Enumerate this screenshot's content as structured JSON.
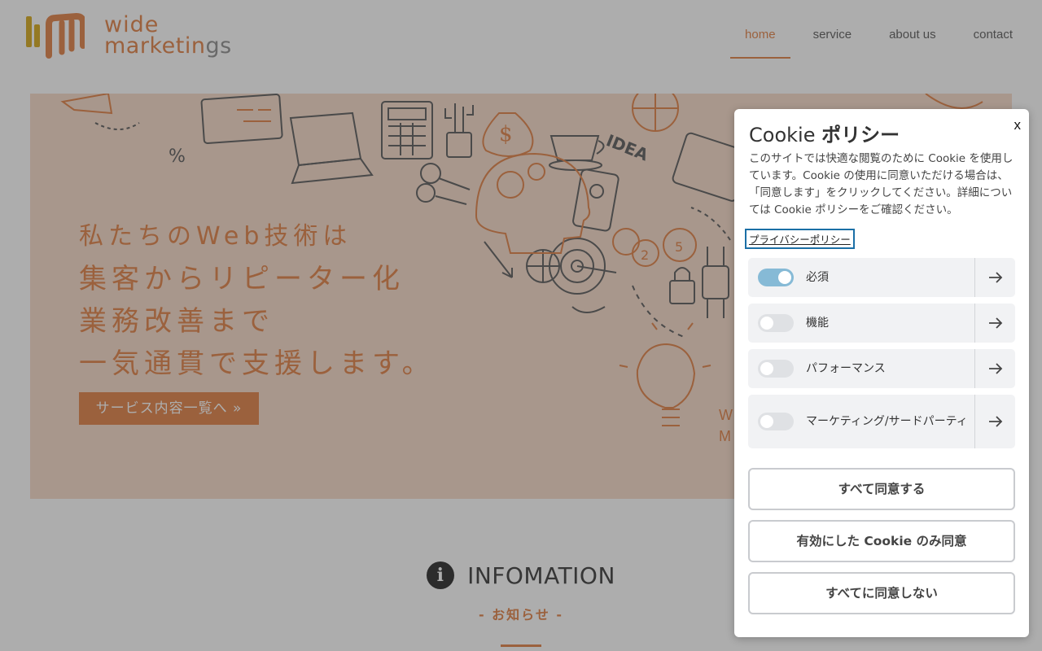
{
  "header": {
    "logo": {
      "line1": "wide",
      "line2_a": "marketin",
      "line2_b": "gs"
    },
    "nav": [
      {
        "label": "home",
        "active": true
      },
      {
        "label": "service",
        "active": false
      },
      {
        "label": "about us",
        "active": false
      },
      {
        "label": "contact",
        "active": false
      }
    ]
  },
  "hero": {
    "lines": [
      "私たちのWeb技術は",
      "集客からリピーター化",
      "業務改善まで",
      "一気通貫で支援します。"
    ],
    "button_label": "サービス内容一覧へ »",
    "tag_line1": "W",
    "tag_line2": "M",
    "doodle_labels": {
      "idea": "IDEA",
      "percent": "%",
      "dollar": "$",
      "coin2": "2",
      "coin5": "5"
    }
  },
  "info": {
    "icon_glyph": "i",
    "title": "INFOMATION",
    "subtitle": "- お知らせ -"
  },
  "cookie": {
    "title_prefix": "Cookie",
    "title_bold": "ポリシー",
    "close_label": "x",
    "description": "このサイトでは快適な閲覧のために Cookie を使用しています。Cookie の使用に同意いただける場合は、「同意します」をクリックしてください。詳細については Cookie ポリシーをご確認ください。",
    "privacy_link": "プライバシーポリシー",
    "categories": [
      {
        "label": "必須",
        "enabled": true
      },
      {
        "label": "機能",
        "enabled": false
      },
      {
        "label": "パフォーマンス",
        "enabled": false
      },
      {
        "label": "マーケティング/サードパーティ",
        "enabled": false
      }
    ],
    "buttons": {
      "accept_all": "すべて同意する",
      "accept_selected": "有効にした Cookie のみ同意",
      "reject_all": "すべてに同意しない"
    }
  },
  "colors": {
    "accent": "#e07c3e",
    "hero_bg": "#f6d9c7",
    "toggle_on": "#86bad6",
    "link_focus": "#1b6fa6"
  },
  "icons": {
    "logo": "wide-marketings-logo",
    "info": "info-circle-icon",
    "category_arrow": "arrow-right-icon",
    "close": "close-icon"
  }
}
